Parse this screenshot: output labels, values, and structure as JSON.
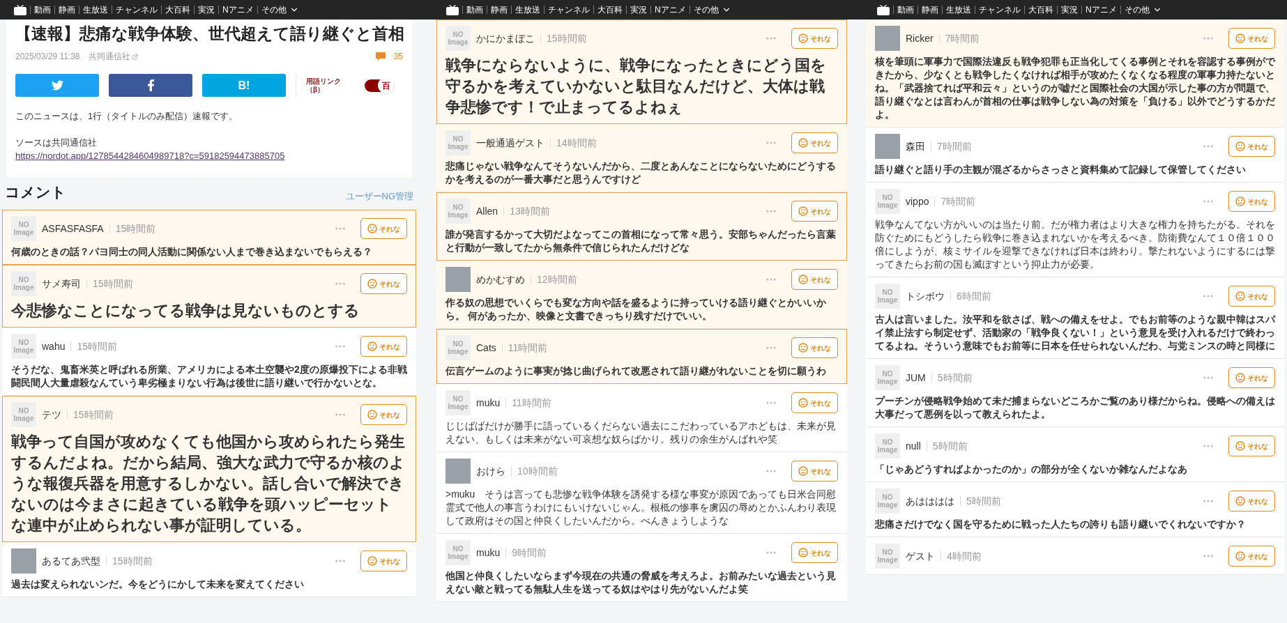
{
  "panels": [
    {
      "nav": {
        "items": [
          "動画",
          "静画",
          "生放送",
          "チャンネル",
          "大百科",
          "実況",
          "Nアニメ"
        ],
        "more": "その他"
      },
      "article": {
        "title": "【速報】悲痛な戦争体験、世代超えて語り継ぐと首相",
        "date": "2025/03/29 11:38",
        "source": "共同通信社",
        "comment_count": "35",
        "share_buttons": [
          {
            "kind": "twitter"
          },
          {
            "kind": "facebook"
          },
          {
            "kind": "hatena",
            "label": "B!"
          }
        ],
        "term_link": {
          "label": "用語リンク（β）",
          "on": true,
          "knob": "百"
        },
        "body": [
          "このニュースは、1行（タイトルのみ配信）速報です。",
          "ソースは共同通信社"
        ],
        "link": "https://nordot.app/1278544284604989718?c=59182594473885705"
      },
      "comments_heading": "コメント",
      "ng_link": "ユーザーNG管理",
      "comments": [
        {
          "kind": "no-image",
          "avatar_text": [
            "NO",
            "Image"
          ],
          "name": "ASFASFASFA",
          "time": "15時間前",
          "bordered": true,
          "tinted": true,
          "large": false,
          "bold": true,
          "text": "何歳のときの話？パヨ同士の同人活動に関係ない人まで巻き込まないでもらえる？",
          "reaction": "それな"
        },
        {
          "kind": "no-image",
          "avatar_text": [
            "NO",
            "Image"
          ],
          "name": "サメ寿司",
          "time": "15時間前",
          "bordered": true,
          "tinted": true,
          "large": true,
          "bold": true,
          "text": "今悲惨なことになってる戦争は見ないものとする",
          "reaction": "それな"
        },
        {
          "kind": "no-image",
          "avatar_text": [
            "NO",
            "Image"
          ],
          "name": "wahu",
          "time": "15時間前",
          "bordered": false,
          "tinted": false,
          "large": false,
          "bold": true,
          "text": "そうだな、鬼畜米英と呼ばれる所業、アメリカによる本土空襲や2度の原爆投下による非戦闘民間人大量虐殺なんていう卑劣極まりない行為は後世に語り継いで行かないとな。",
          "reaction": "それな"
        },
        {
          "kind": "no-image",
          "avatar_text": [
            "NO",
            "Image"
          ],
          "name": "テツ",
          "time": "15時間前",
          "bordered": true,
          "tinted": true,
          "large": true,
          "bold": true,
          "text": "戦争って自国が攻めなくても他国から攻められたら発生するんだよね。だから結局、強大な武力で守るか核のような報復兵器を用意するしかない。話し合いで解決できないのは今まさに起きている戦争を頭ハッピーセットな連中が止められない事が証明している。",
          "reaction": "それな"
        },
        {
          "kind": "photo",
          "name": "あるてあ弐型",
          "time": "15時間前",
          "bordered": false,
          "tinted": false,
          "large": false,
          "bold": true,
          "text": "過去は変えられないンだ。今をどうにかして未来を変えてください",
          "reaction": "それな"
        }
      ]
    },
    {
      "nav": {
        "items": [
          "動画",
          "静画",
          "生放送",
          "チャンネル",
          "大百科",
          "実況",
          "Nアニメ"
        ],
        "more": "その他"
      },
      "comments": [
        {
          "kind": "no-image",
          "avatar_text": [
            "NO",
            "Image"
          ],
          "name": "かにかまぼこ",
          "time": "15時間前",
          "bordered": true,
          "tinted": true,
          "large": true,
          "bold": true,
          "text": "戦争にならないように、戦争になったときにどう国を守るかを考えていかないと駄目なんだけど、大体は戦争悲惨です！で止まってるよねぇ",
          "reaction": "それな"
        },
        {
          "kind": "no-image",
          "avatar_text": [
            "NO",
            "Image"
          ],
          "name": "一般通過ゲスト",
          "time": "14時間前",
          "bordered": false,
          "tinted": true,
          "large": false,
          "bold": true,
          "text": "悲痛じゃない戦争なんてそうないんだから、二度とあんなことにならないためにどうするかを考えるのが一番大事だと思うんですけど",
          "reaction": "それな"
        },
        {
          "kind": "no-image",
          "avatar_text": [
            "NO",
            "Image"
          ],
          "name": "Allen",
          "time": "13時間前",
          "bordered": true,
          "tinted": true,
          "large": false,
          "bold": true,
          "text": "誰が発言するかって大切だよなってこの首相になって常々思う。安部ちゃんだったら言葉と行動が一致してたから無条件で信じられたんだけどな",
          "reaction": "それな"
        },
        {
          "kind": "photo",
          "name": "めかむすめ",
          "time": "12時間前",
          "bordered": false,
          "tinted": true,
          "large": false,
          "bold": true,
          "text": "作る奴の思想でいくらでも変な方向や話を盛るように持っていける語り継ぐとかいいから。 何があったか、映像と文書できっちり残すだけでいい。",
          "reaction": "それな"
        },
        {
          "kind": "no-image",
          "avatar_text": [
            "NO",
            "Image"
          ],
          "name": "Cats",
          "time": "11時間前",
          "bordered": true,
          "tinted": true,
          "large": false,
          "bold": true,
          "text": "伝言ゲームのように事実が捻じ曲げられて改悪されて語り継がれないことを切に願うわ",
          "reaction": "それな"
        },
        {
          "kind": "no-image",
          "avatar_text": [
            "NO",
            "Image"
          ],
          "name": "muku",
          "time": "11時間前",
          "bordered": false,
          "tinted": false,
          "large": false,
          "bold": false,
          "text": "じじばばだけが勝手に語っているくだらない過去にこだわっているアホどもは、未来が見えない、もしくは未来がない可哀想な奴らばかり。残りの余生がんばれや笑",
          "reaction": "それな"
        },
        {
          "kind": "photo",
          "name": "おけら",
          "time": "10時間前",
          "bordered": false,
          "tinted": false,
          "large": false,
          "bold": false,
          "text": ">muku　そうは言っても悲惨な戦争体験を誘発する様な事変が原因であっても日米合同慰霊式で他人の事言うわけにもいけないじゃん。根柢の惨事を虜囚の辱めとかふんわり表現して政府はその国と仲良くしたいんだから。べんきょうしような",
          "reaction": "それな"
        },
        {
          "kind": "no-image",
          "avatar_text": [
            "NO",
            "Image"
          ],
          "name": "muku",
          "time": "9時間前",
          "bordered": false,
          "tinted": false,
          "large": false,
          "bold": true,
          "text": "他国と仲良くしたいならまず今現在の共通の脅威を考えろよ。お前みたいな過去という見えない敵と戦ってる無駄人生を送ってる奴はやはり先がないんだよ笑",
          "reaction": "それな"
        }
      ]
    },
    {
      "nav": {
        "items": [
          "動画",
          "静画",
          "生放送",
          "チャンネル",
          "大百科",
          "実況",
          "Nアニメ"
        ],
        "more": "その他"
      },
      "comments": [
        {
          "kind": "photo",
          "name": "Ricker",
          "time": "7時間前",
          "bordered": false,
          "tinted": true,
          "large": false,
          "bold": true,
          "text": "核を筆頭に軍事力で国際法違反も戦争犯罪も正当化してくる事例とそれを容認する事例ができたから、少なくとも戦争したくなければ相手が攻めたくなくなる程度の軍事力持たないとね。「武器捨てれば平和云々」というのが嘘だと国際社会の大国が示した事の方が問題で、語り継ぐなとは言わんが首相の仕事は戦争しない為の対策を「負ける」以外でどうするかだよ。",
          "reaction": "それな"
        },
        {
          "kind": "photo",
          "name": "森田",
          "time": "7時間前",
          "bordered": false,
          "tinted": false,
          "large": false,
          "bold": true,
          "text": "語り継ぐと語り手の主観が混ざるからさっさと資料集めて記録して保管してください",
          "reaction": "それな"
        },
        {
          "kind": "no-image",
          "avatar_text": [
            "NO",
            "Image"
          ],
          "name": "vippo",
          "time": "7時間前",
          "bordered": false,
          "tinted": false,
          "large": false,
          "bold": false,
          "text": "戦争なんてない方がいいのは当たり前。だが権力者はより大きな権力を持ちたがる。それを防ぐためにもどうしたら戦争に巻き込まれないかを考えるべき。防衛費なんて１０倍１００倍にしようが、核ミサイルを迎撃できなければ日本は終わり。撃たれないようにするには撃ってきたらお前の国も滅ぼすという抑止力が必要。",
          "reaction": "それな"
        },
        {
          "kind": "no-image",
          "avatar_text": [
            "NO",
            "Image"
          ],
          "name": "トシボウ",
          "time": "6時間前",
          "bordered": false,
          "tinted": false,
          "large": false,
          "bold": true,
          "text": "古人は言いました。汝平和を欲さば、戦への備えをせよ。でもお前等のような親中韓はスパイ禁止法すら制定せず、活動家の「戦争良くない！」という意見を受け入れるだけで終わってるよね。そういう意味でもお前等に日本を任せられないんだわ、与党ミンスの時と同様に",
          "reaction": "それな"
        },
        {
          "kind": "no-image",
          "avatar_text": [
            "NO",
            "Image"
          ],
          "name": "JUM",
          "time": "5時間前",
          "bordered": false,
          "tinted": false,
          "large": false,
          "bold": true,
          "text": "プーチンが侵略戦争始めて未だ捕まらないどころかご覧のあり様だからね。侵略への備えは大事だって悪例を以って教えられたよ。",
          "reaction": "それな"
        },
        {
          "kind": "no-image",
          "avatar_text": [
            "NO",
            "Image"
          ],
          "name": "null",
          "time": "5時間前",
          "bordered": false,
          "tinted": false,
          "large": false,
          "bold": true,
          "text": "「じゃあどうすればよかったのか」の部分が全くないか雑なんだよなあ",
          "reaction": "それな"
        },
        {
          "kind": "no-image",
          "avatar_text": [
            "NO",
            "Image"
          ],
          "name": "あはははは",
          "time": "5時間前",
          "bordered": false,
          "tinted": false,
          "large": false,
          "bold": true,
          "text": "悲痛さだけでなく国を守るために戦った人たちの誇りも語り継いでくれないですか？",
          "reaction": "それな"
        },
        {
          "kind": "no-image",
          "avatar_text": [
            "NO",
            "Image"
          ],
          "name": "ゲスト",
          "time": "4時間前",
          "bordered": false,
          "tinted": false,
          "reaction": "それな"
        }
      ]
    }
  ]
}
